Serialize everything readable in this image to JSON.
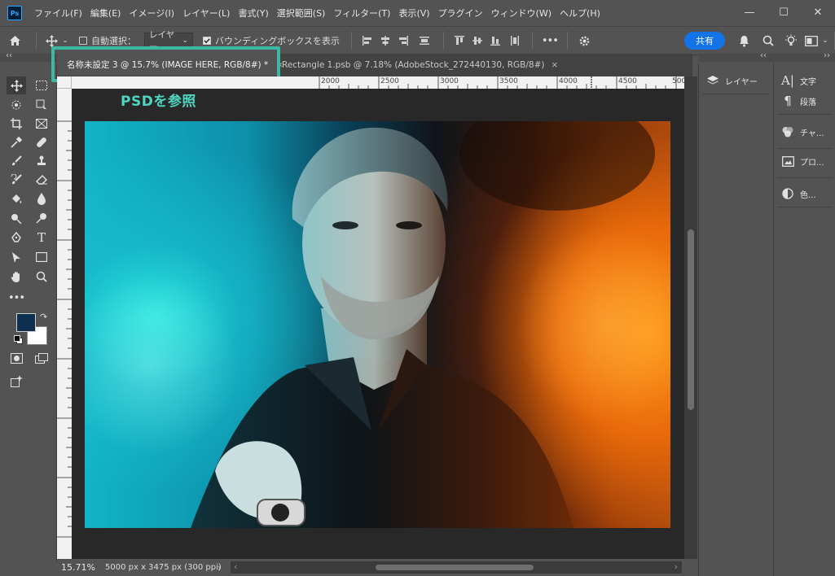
{
  "app": {
    "logo": "Ps"
  },
  "menu": [
    "ファイル(F)",
    "編集(E)",
    "イメージ(I)",
    "レイヤー(L)",
    "書式(Y)",
    "選択範囲(S)",
    "フィルター(T)",
    "表示(V)",
    "プラグイン",
    "ウィンドウ(W)",
    "ヘルプ(H)"
  ],
  "window_controls": {
    "minimize": "—",
    "maximize": "☐",
    "close": "✕"
  },
  "options": {
    "auto_select_label": "自動選択：",
    "auto_select_checked": false,
    "auto_select_target": "レイヤー",
    "bounding_box_label": "バウンディングボックスを表示",
    "bounding_box_checked": true,
    "more": "•••",
    "share_label": "共有"
  },
  "collapse_glyph": "‹‹",
  "collapse_glyph_right": "››",
  "tabs": [
    {
      "label": "名称未設定 3 @ 15.7% (IMAGE HERE, RGB/8#) *",
      "close": "×",
      "active": true
    },
    {
      "label": "Rectangle 1.psb @ 7.18% (AdobeStock_272440130, RGB/8#)",
      "close": "×",
      "active": false
    }
  ],
  "annotation": "PSDを参照",
  "ruler_h_ticks": [
    "2000",
    "2500",
    "3000",
    "3500",
    "4000",
    "4500",
    "500"
  ],
  "status": {
    "zoom": "15.71%",
    "doc_info": "5000 px x 3475 px (300 ppi)",
    "arrow": "›",
    "scroll_left": "‹",
    "scroll_right": "›"
  },
  "panels_col1": [
    {
      "icon": "layers-icon",
      "label": "レイヤー"
    }
  ],
  "panels_col2": [
    {
      "icon": "character-icon",
      "label": "文字"
    },
    {
      "icon": "paragraph-icon",
      "label": "段落"
    },
    {
      "icon": "channels-icon",
      "label": "チャ..."
    },
    {
      "icon": "properties-icon",
      "label": "プロ..."
    },
    {
      "icon": "color-icon",
      "label": "色..."
    }
  ],
  "colors": {
    "foreground": "#0e3050",
    "background": "#ffffff",
    "accent": "#1473e6",
    "highlight": "#3ab8a4"
  }
}
